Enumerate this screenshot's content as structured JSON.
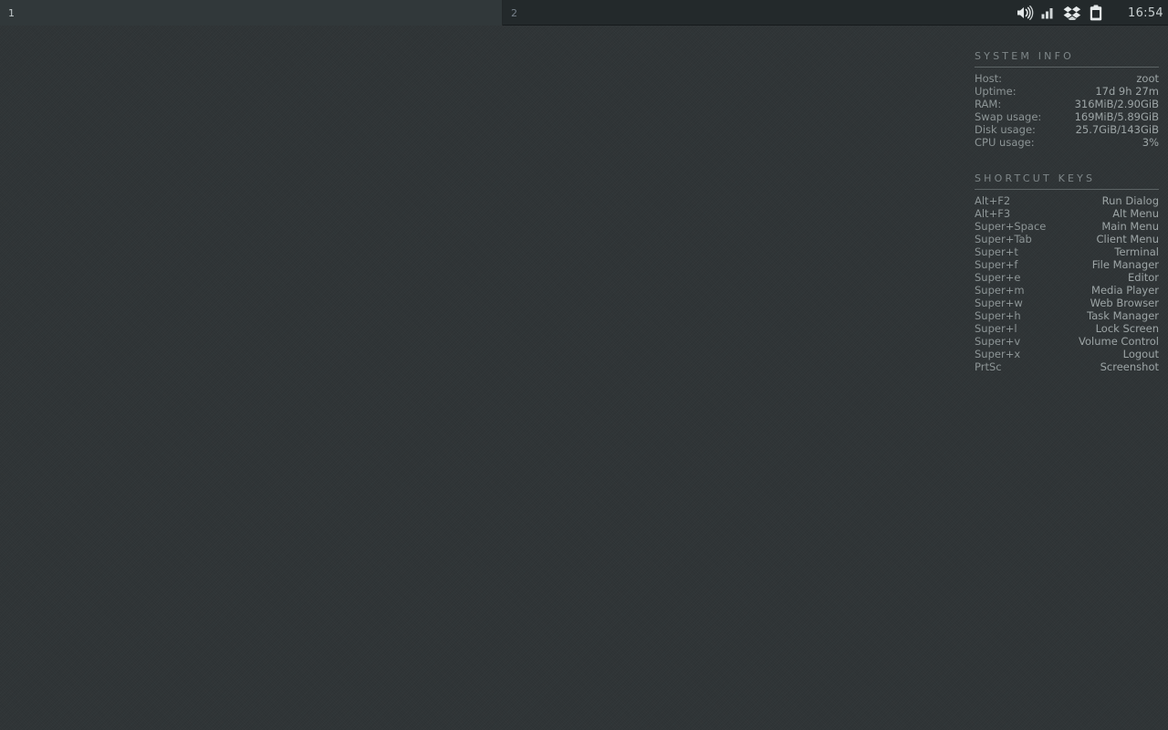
{
  "panel": {
    "workspaces": [
      {
        "label": "1",
        "active": true
      },
      {
        "label": "2",
        "active": false
      }
    ],
    "tray": [
      {
        "name": "volume-icon",
        "title": "Volume"
      },
      {
        "name": "network-signal-icon",
        "title": "Network"
      },
      {
        "name": "dropbox-icon",
        "title": "Dropbox"
      },
      {
        "name": "clipboard-icon",
        "title": "Clipboard"
      }
    ],
    "clock": "16:54"
  },
  "system_info": {
    "title": "SYSTEM INFO",
    "rows": [
      {
        "key": "Host:",
        "value": "zoot"
      },
      {
        "key": "Uptime:",
        "value": "17d 9h 27m"
      },
      {
        "key": "RAM:",
        "value": "316MiB/2.90GiB"
      },
      {
        "key": "Swap usage:",
        "value": "169MiB/5.89GiB"
      },
      {
        "key": "Disk usage:",
        "value": "25.7GiB/143GiB"
      },
      {
        "key": "CPU usage:",
        "value": "3%"
      }
    ]
  },
  "shortcut_keys": {
    "title": "SHORTCUT KEYS",
    "rows": [
      {
        "key": "Alt+F2",
        "value": "Run Dialog"
      },
      {
        "key": "Alt+F3",
        "value": "Alt Menu"
      },
      {
        "key": "Super+Space",
        "value": "Main Menu"
      },
      {
        "key": "Super+Tab",
        "value": "Client Menu"
      },
      {
        "key": "Super+t",
        "value": "Terminal"
      },
      {
        "key": "Super+f",
        "value": "File Manager"
      },
      {
        "key": "Super+e",
        "value": "Editor"
      },
      {
        "key": "Super+m",
        "value": "Media Player"
      },
      {
        "key": "Super+w",
        "value": "Web Browser"
      },
      {
        "key": "Super+h",
        "value": "Task Manager"
      },
      {
        "key": "Super+l",
        "value": "Lock Screen"
      },
      {
        "key": "Super+v",
        "value": "Volume Control"
      },
      {
        "key": "Super+x",
        "value": "Logout"
      },
      {
        "key": "PrtSc",
        "value": "Screenshot"
      }
    ]
  },
  "colors": {
    "desktop_bg": "#2f3436",
    "panel_bg": "#23292b",
    "panel_active_ws": "#31383a",
    "text_dim": "#8d9596",
    "text_bright": "#c8cfd0"
  }
}
